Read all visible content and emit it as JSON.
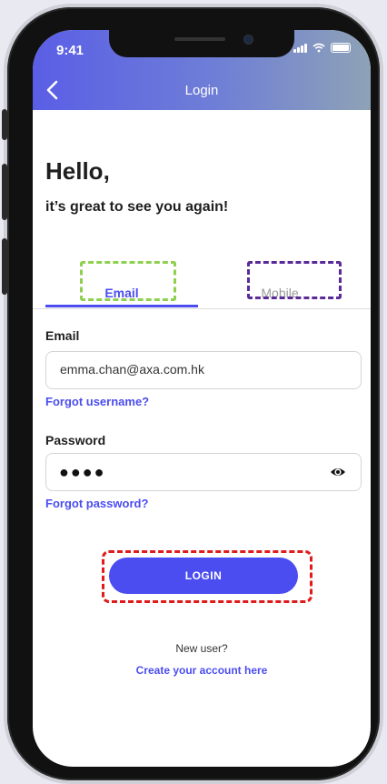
{
  "status_bar": {
    "time": "9:41"
  },
  "header": {
    "title": "Login",
    "back_icon": "chevron-left-icon"
  },
  "greeting": {
    "title": "Hello,",
    "subtitle": "it’s great to see you again!"
  },
  "tabs": [
    {
      "label": "Email",
      "active": true
    },
    {
      "label": "Mobile",
      "active": false
    }
  ],
  "email": {
    "label": "Email",
    "value": "emma.chan@axa.com.hk",
    "forgot_link": "Forgot username?"
  },
  "password": {
    "label": "Password",
    "masked_value": "●●●●",
    "toggle_icon": "eye-icon",
    "forgot_link": "Forgot password?"
  },
  "login_button": {
    "label": "LOGIN"
  },
  "signup": {
    "prompt": "New user?",
    "link": "Create your account here"
  },
  "colors": {
    "accent": "#4b4df0",
    "highlight_email": "#8fd14f",
    "highlight_mobile": "#5a2a99",
    "highlight_login": "#e01b1b"
  }
}
